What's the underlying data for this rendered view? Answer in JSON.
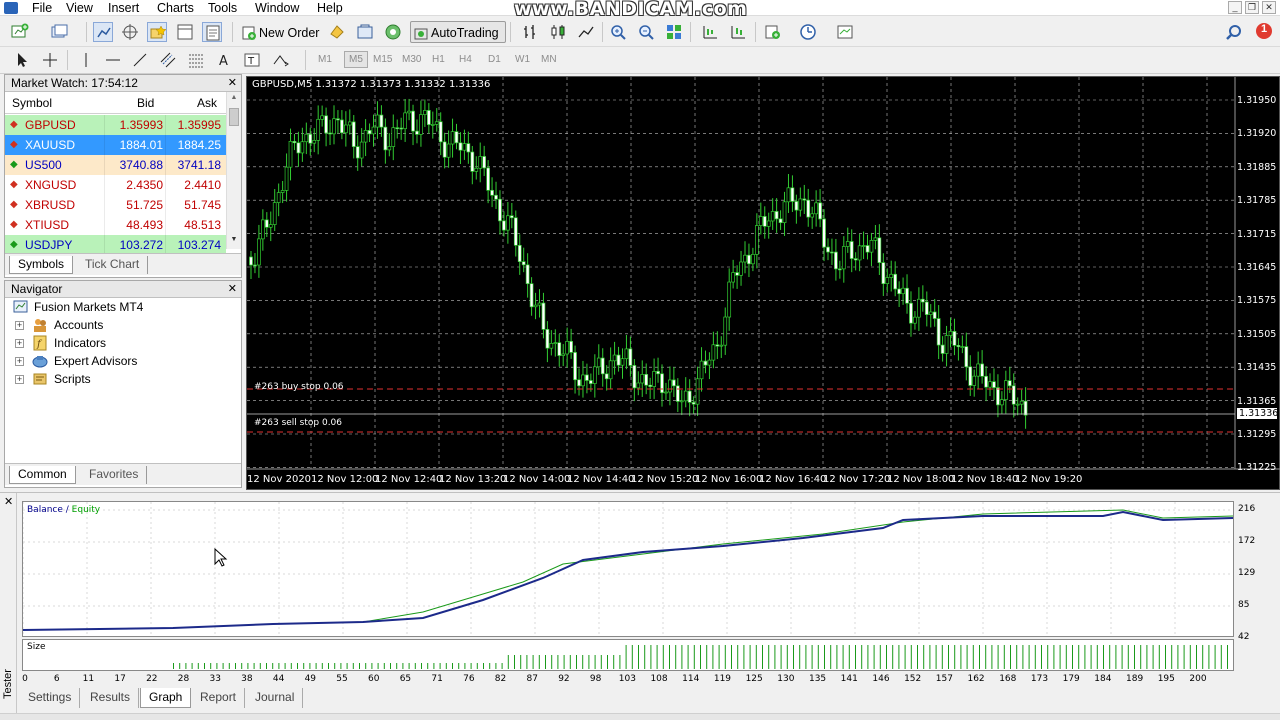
{
  "watermark": "www.BANDICAM.com",
  "menu": [
    "File",
    "View",
    "Insert",
    "Charts",
    "Tools",
    "Window",
    "Help"
  ],
  "toolbar": {
    "new_order": "New Order",
    "autotrading": "AutoTrading"
  },
  "timeframes": [
    "M1",
    "M5",
    "M15",
    "M30",
    "H1",
    "H4",
    "D1",
    "W1",
    "MN"
  ],
  "notification_count": "1",
  "market_watch": {
    "title": "Market Watch: 17:54:12",
    "columns": [
      "Symbol",
      "Bid",
      "Ask"
    ],
    "rows": [
      {
        "symbol": "GBPUSD",
        "bid": "1.35993",
        "ask": "1.35995",
        "bg": "#b9f2b9",
        "dir": "down",
        "color": "#c00000"
      },
      {
        "symbol": "XAUUSD",
        "bid": "1884.01",
        "ask": "1884.25",
        "bg": "#3399ff",
        "dir": "down",
        "color": "#ffffff"
      },
      {
        "symbol": "US500",
        "bid": "3740.88",
        "ask": "3741.18",
        "bg": "#fde9c9",
        "dir": "up",
        "color": "#0000c0"
      },
      {
        "symbol": "XNGUSD",
        "bid": "2.4350",
        "ask": "2.4410",
        "bg": "#ffffff",
        "dir": "down",
        "color": "#c00000"
      },
      {
        "symbol": "XBRUSD",
        "bid": "51.725",
        "ask": "51.745",
        "bg": "#ffffff",
        "dir": "down",
        "color": "#c00000"
      },
      {
        "symbol": "XTIUSD",
        "bid": "48.493",
        "ask": "48.513",
        "bg": "#ffffff",
        "dir": "down",
        "color": "#c00000"
      },
      {
        "symbol": "USDJPY",
        "bid": "103.272",
        "ask": "103.274",
        "bg": "#b9f2b9",
        "dir": "up",
        "color": "#0000c0"
      }
    ],
    "tabs": [
      "Symbols",
      "Tick Chart"
    ]
  },
  "navigator": {
    "title": "Navigator",
    "root": "Fusion Markets MT4",
    "items": [
      "Accounts",
      "Indicators",
      "Expert Advisors",
      "Scripts"
    ],
    "tabs": [
      "Common",
      "Favorites"
    ]
  },
  "chart": {
    "header": "GBPUSD,M5  1.31372 1.31373 1.31332 1.31336",
    "price_labels": [
      "1.31950",
      "1.31920",
      "1.31885",
      "1.31785",
      "1.31715",
      "1.31645",
      "1.31575",
      "1.31505",
      "1.31435",
      "1.31365",
      "1.31295",
      "1.31225"
    ],
    "current_price": "1.31336",
    "time_labels": [
      "12 Nov 2020",
      "12 Nov 12:00",
      "12 Nov 12:40",
      "12 Nov 13:20",
      "12 Nov 14:00",
      "12 Nov 14:40",
      "12 Nov 15:20",
      "12 Nov 16:00",
      "12 Nov 16:40",
      "12 Nov 17:20",
      "12 Nov 18:00",
      "12 Nov 18:40",
      "12 Nov 19:20"
    ],
    "orders": [
      {
        "text": "#263 buy stop 0.06",
        "prefix": "#263 b"
      },
      {
        "text": "#263 sell stop 0.06",
        "prefix": "#263 s"
      }
    ]
  },
  "tester": {
    "side_label": "Tester",
    "graph_title": {
      "balance": "Balance",
      "sep": " / ",
      "equity": "Equity"
    },
    "y_labels": [
      "216",
      "172",
      "129",
      "85",
      "42"
    ],
    "size_label": "Size",
    "x_labels": [
      "0",
      "6",
      "11",
      "17",
      "22",
      "28",
      "33",
      "38",
      "44",
      "49",
      "55",
      "60",
      "65",
      "71",
      "76",
      "82",
      "87",
      "92",
      "98",
      "103",
      "108",
      "114",
      "119",
      "125",
      "130",
      "135",
      "141",
      "146",
      "152",
      "157",
      "162",
      "168",
      "173",
      "179",
      "184",
      "189",
      "195",
      "200"
    ],
    "tabs": [
      "Settings",
      "Results",
      "Graph",
      "Report",
      "Journal"
    ],
    "active_tab": "Graph"
  }
}
